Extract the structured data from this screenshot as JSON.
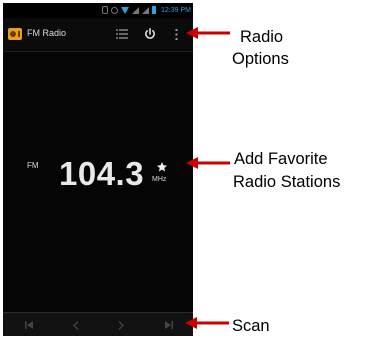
{
  "statusbar": {
    "time": "12:39 PM"
  },
  "actionbar": {
    "title": "FM Radio",
    "icons": {
      "app": "radio-icon",
      "list": "list-icon",
      "power": "power-icon",
      "menu": "overflow-menu-icon"
    }
  },
  "tuner": {
    "band": "FM",
    "frequency": "104.3",
    "unit": "MHz",
    "favorite_icon": "star-icon"
  },
  "bottombar": {
    "icons": [
      "skip-previous-icon",
      "chevron-left-icon",
      "chevron-right-icon",
      "skip-next-icon"
    ]
  },
  "callouts": {
    "options_line1": "Radio",
    "options_line2": "Options",
    "favorite_line1": "Add Favorite",
    "favorite_line2": "Radio Stations",
    "scan": "Scan"
  },
  "colors": {
    "arrow": "#cc0000",
    "accent": "#2aa7d8",
    "app_icon": "#e6a020"
  }
}
